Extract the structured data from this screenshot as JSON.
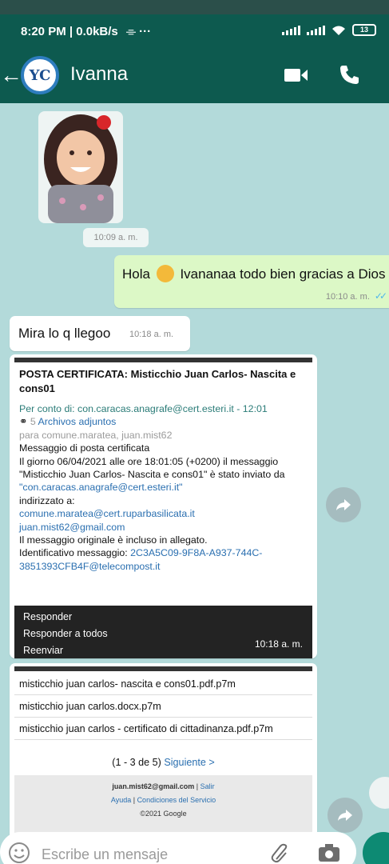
{
  "status": {
    "time": "8:20 PM | 0.0kB/s",
    "extra": "⌯ ···",
    "battery": "13"
  },
  "header": {
    "back": "←",
    "avatar_initials": "YC",
    "contact_name": "Ivanna"
  },
  "messages": {
    "sticker_time": "10:09 a. m.",
    "outgoing": {
      "text_a": "Hola",
      "text_b": "Ivananaa todo bien gracias a Dios",
      "time": "10:10 a. m."
    },
    "incoming": {
      "text": "Mira lo q llegoo",
      "time": "10:18 a. m."
    }
  },
  "email": {
    "subject": "POSTA CERTIFICATA: Misticchio Juan Carlos- Nascita e cons01",
    "per_conto_di": "Per conto di: con.caracas.anagrafe@cert.esteri.it - 12:01",
    "attach_count": "5",
    "attach_label": "Archivos adjuntos",
    "to_line": "para comune.maratea, juan.mist62",
    "body_1": "Messaggio di posta certificata",
    "body_2": "Il giorno 06/04/2021 alle ore 18:01:05 (+0200) il messaggio",
    "body_3": "\"Misticchio Juan Carlos- Nascita e cons01\" è stato inviato da ",
    "body_3_link": "\"con.caracas.anagrafe@cert.esteri.it\"",
    "body_4": "indirizzato a:",
    "recipient_1": "comune.maratea@cert.ruparbasilicata.it",
    "recipient_2": "juan.mist62@gmail.com",
    "body_5": "Il messaggio originale è incluso in allegato.",
    "body_6": "Identificativo messaggio: ",
    "message_id": "2C3A5C09-9F8A-A937-744C-3851393CFB4F@telecompost.it",
    "menu": [
      "Responder",
      "Responder a todos",
      "Reenviar"
    ],
    "time": "10:18 a. m."
  },
  "attachments": {
    "files": [
      "misticchio juan carlos- nascita e cons01.pdf.p7m",
      "misticchio juan carlos.docx.p7m",
      "misticchio juan carlos - certificato di cittadinanza.pdf.p7m"
    ],
    "pager": "(1 - 3 de 5) ",
    "pager_next": "Siguiente >",
    "footer_account": "juan.mist62@gmail.com",
    "footer_exit": "Salir",
    "footer_help": "Ayuda",
    "footer_terms": "Condiciones del Servicio",
    "footer_copy": "©2021 Google"
  },
  "input": {
    "placeholder": "Escribe un mensaje"
  },
  "colors": {
    "header": "#0d5a4f",
    "outgoing_bubble": "#dcf8c6",
    "chat_bg": "#b3dada",
    "link": "#2a6fb0",
    "read_ticks": "#4fb6ec"
  },
  "icons": [
    "back-arrow-icon",
    "video-call-icon",
    "phone-icon",
    "forward-icon",
    "emoji-icon",
    "attach-icon",
    "camera-icon",
    "mic-icon"
  ]
}
